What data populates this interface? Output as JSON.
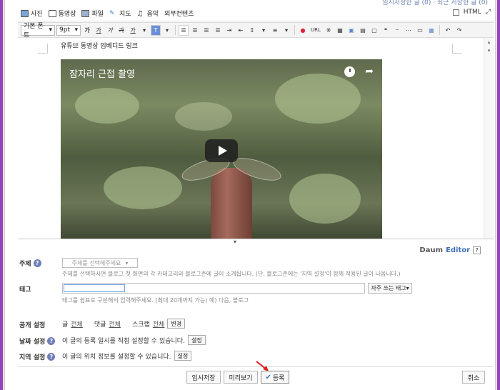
{
  "top_note": "임시저장한 글 (0) · 최근 저장한 글 (0)",
  "toolbar1": {
    "items": [
      {
        "label": "사진",
        "icon": "photo-icon"
      },
      {
        "label": "동영상",
        "icon": "video-icon"
      },
      {
        "label": "파일",
        "icon": "file-icon"
      },
      {
        "label": "지도",
        "icon": "map-icon"
      },
      {
        "label": "음악",
        "icon": "music-icon"
      },
      {
        "label": "외부컨텐츠",
        "icon": ""
      }
    ],
    "html_label": "HTML"
  },
  "toolbar2": {
    "font": "기본 폰트",
    "size": "9pt",
    "bold": "가",
    "underline": "가",
    "italic": "가",
    "strike": "가",
    "color": "가",
    "url": "URL"
  },
  "editor": {
    "caption": "유튜브 동영상 임베디드 링크",
    "video_title": "잠자리 근접 촬영"
  },
  "branding": {
    "daum": "Daum",
    "editor": "Editor"
  },
  "form": {
    "subject_label": "주제",
    "subject_placeholder": "주제를 선택해주세요",
    "subject_hint": "주제를 선택하시면 블로그 첫 화면의 각 카테고리와 블로그존에 글이 소개됩니다. (단, 블로그존에는 '지역 설정'이 함께 적용된 글이 나옵니다.)",
    "tag_label": "태그",
    "tag_button": "자주 쓰는 태그",
    "tag_hint": "태그를 쉼표로 구분해서 입력해주세요. (최대 20개까지 가능) 예) 다음, 블로그",
    "public_label": "공개 설정",
    "public_items": [
      {
        "name": "글",
        "value": "전체"
      },
      {
        "name": "댓글",
        "value": "전체"
      },
      {
        "name": "스크랩",
        "value": "전체"
      }
    ],
    "public_button": "변경",
    "date_label": "날짜 설정",
    "date_text": "이 글의 등록 일시를 직접 설정할 수 있습니다.",
    "date_button": "설정",
    "region_label": "지역 설정",
    "region_text": "이 글의 위치 정보를 설정할 수 있습니다.",
    "region_button": "설정"
  },
  "actions": {
    "temp_save": "임시저장",
    "preview": "미리보기",
    "submit": "등록",
    "cancel": "취소"
  }
}
